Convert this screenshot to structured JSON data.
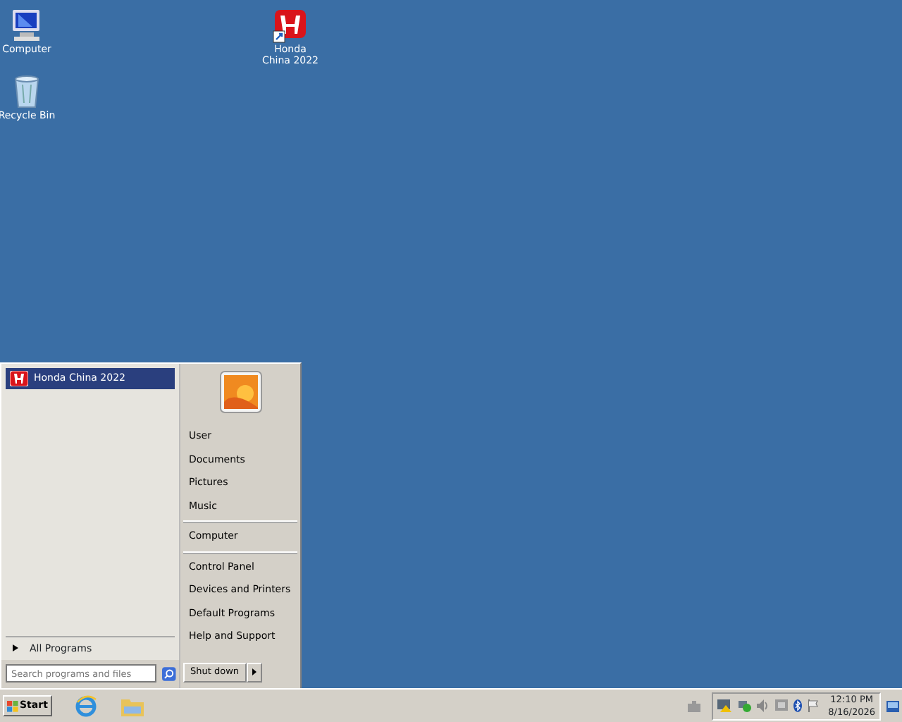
{
  "desktop_icons": [
    {
      "label": "Computer",
      "kind": "computer"
    },
    {
      "label": "Recycle Bin",
      "kind": "recycle"
    },
    {
      "label": "Honda China 2022",
      "kind": "honda"
    }
  ],
  "start_menu": {
    "programs": [
      {
        "label": "Honda China 2022",
        "selected": true
      }
    ],
    "all_programs": "All Programs",
    "search": {
      "placeholder": "Search programs and files"
    },
    "places": [
      [
        {
          "label": "User"
        },
        {
          "label": "Documents"
        },
        {
          "label": "Pictures"
        },
        {
          "label": "Music"
        }
      ],
      [
        {
          "label": "Computer"
        }
      ],
      [
        {
          "label": "Control Panel"
        },
        {
          "label": "Devices and Printers"
        },
        {
          "label": "Default Programs"
        },
        {
          "label": "Help and Support"
        }
      ]
    ],
    "shutdown": "Shut down"
  },
  "taskbar": {
    "start": "Start",
    "clock": {
      "time": "12:10 PM",
      "date": "8/16/2026"
    }
  }
}
